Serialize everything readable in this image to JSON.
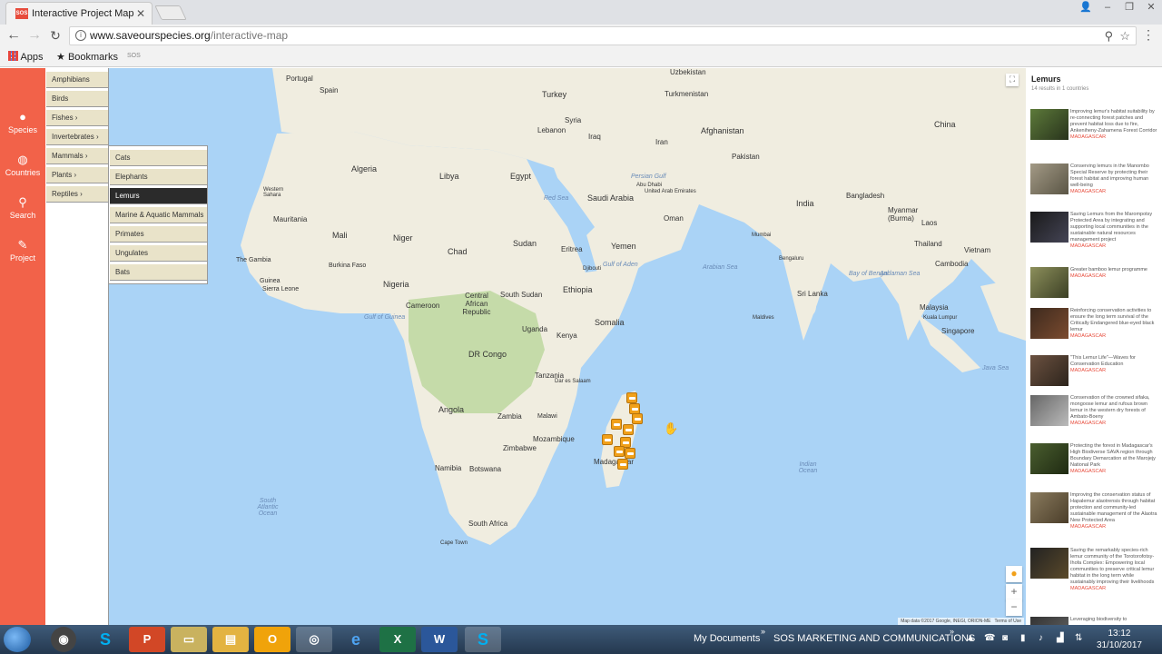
{
  "browser": {
    "tab_title": "Interactive Project Map",
    "favicon_text": "SOS",
    "url_domain": "www.saveourspecies.org",
    "url_path": "/interactive-map",
    "bookmarks": {
      "apps": "Apps",
      "bookmarks": "Bookmarks",
      "sos": "SOS"
    }
  },
  "sidebar": [
    {
      "label": "Species",
      "icon": "species-icon"
    },
    {
      "label": "Countries",
      "icon": "globe-icon"
    },
    {
      "label": "Search",
      "icon": "search-icon"
    },
    {
      "label": "Project",
      "icon": "edit-icon"
    }
  ],
  "categories": [
    "Amphibians",
    "Birds",
    "Fishes",
    "Invertebrates",
    "Mammals",
    "Plants",
    "Reptiles"
  ],
  "subcategories": [
    "Cats",
    "Elephants",
    "Lemurs",
    "Marine & Aquatic Mammals",
    "Primates",
    "Ungulates",
    "Bats"
  ],
  "selected_subcategory": "Lemurs",
  "map": {
    "countries": [
      "Portugal",
      "Spain",
      "Turkey",
      "Turkmenistan",
      "Uzbekistan",
      "Syria",
      "Lebanon",
      "Iraq",
      "Iran",
      "Afghanistan",
      "China",
      "Pakistan",
      "Algeria",
      "Libya",
      "Egypt",
      "Saudi Arabia",
      "Western Sahara",
      "Mauritania",
      "Mali",
      "Niger",
      "Chad",
      "Sudan",
      "Eritrea",
      "Yemen",
      "Oman",
      "India",
      "Bangladesh",
      "Myanmar (Burma)",
      "Thailand",
      "Laos",
      "Vietnam",
      "Cambodia",
      "The Gambia",
      "Guinea",
      "Sierra Leone",
      "Burkina Faso",
      "Nigeria",
      "Ethiopia",
      "Somalia",
      "Cameroon",
      "Central African Republic",
      "South Sudan",
      "Uganda",
      "Kenya",
      "DR Congo",
      "Tanzania",
      "Angola",
      "Zambia",
      "Malawi",
      "Mozambique",
      "Zimbabwe",
      "Namibia",
      "Botswana",
      "Madagascar",
      "South Africa",
      "Sri Lanka",
      "Malaysia",
      "Singapore"
    ],
    "cities": [
      "Cape Town",
      "Dar es Salaam",
      "Bengaluru",
      "Mumbai",
      "Abu Dhabi",
      "United Arab Emirates",
      "Djibouti",
      "Maldives",
      "Kuala Lumpur"
    ],
    "seas": [
      "South Atlantic Ocean",
      "Indian Ocean",
      "Arabian Sea",
      "Bay of Bengal",
      "Gulf of Guinea",
      "Gulf of Aden",
      "Andaman Sea",
      "Java Sea",
      "Red Sea",
      "Persian Gulf"
    ],
    "attribution": "Map data ©2017 Google, INEGI, ORION-ME",
    "terms": "Terms of Use"
  },
  "results": {
    "title": "Lemurs",
    "count_text": "14 results in 1 countries",
    "items": [
      {
        "text": "Improving lemur's habitat suitability by re-connecting forest patches and prevent habitat loss due to fire, Ankeniheny-Zahamena Forest Corridor",
        "country": "MADAGASCAR"
      },
      {
        "text": "Conserving lemurs in the Manombo Special Reserve by protecting their forest habitat and improving human well-being",
        "country": "MADAGASCAR"
      },
      {
        "text": "Saving Lemurs from the Marompotsy Protected Area by integrating and supporting local communities in the sustainable natural resources management project",
        "country": "MADAGASCAR"
      },
      {
        "text": "Greater bamboo lemur programme",
        "country": "MADAGASCAR"
      },
      {
        "text": "Reinforcing conservation activities to ensure the long term survival of the Critically Endangered blue-eyed black lemur",
        "country": "MADAGASCAR"
      },
      {
        "text": "\"This Lemur Life\"—Waves for Conservation Education",
        "country": "MADAGASCAR"
      },
      {
        "text": "Conservation of the crowned sifaka, mongoose lemur and rufous brown lemur in the western dry forests of Ambato-Boeny",
        "country": "MADAGASCAR"
      },
      {
        "text": "Protecting the forest in Madagascar's High Biodiverse SAVA region through Boundary Demarcation at the Marojejy National Park",
        "country": "MADAGASCAR"
      },
      {
        "text": "Improving the conservation status of Hapalemur alaotrensis through habitat protection and community-led sustainable management of the Alaotra New Protected Area",
        "country": "MADAGASCAR"
      },
      {
        "text": "Saving the remarkably species-rich lemur community of the Torotorofotsy-Ihofa Complex: Empowering local communities to preserve critical lemur habitat in the long term while sustainably improving their livelihoods",
        "country": "MADAGASCAR"
      },
      {
        "text": "Leveraging biodiversity to",
        "country": ""
      }
    ]
  },
  "taskbar": {
    "folder1": "My Documents",
    "folder2": "SOS MARKETING AND COMMUNICATIONS",
    "time": "13:12",
    "date": "31/10/2017"
  }
}
